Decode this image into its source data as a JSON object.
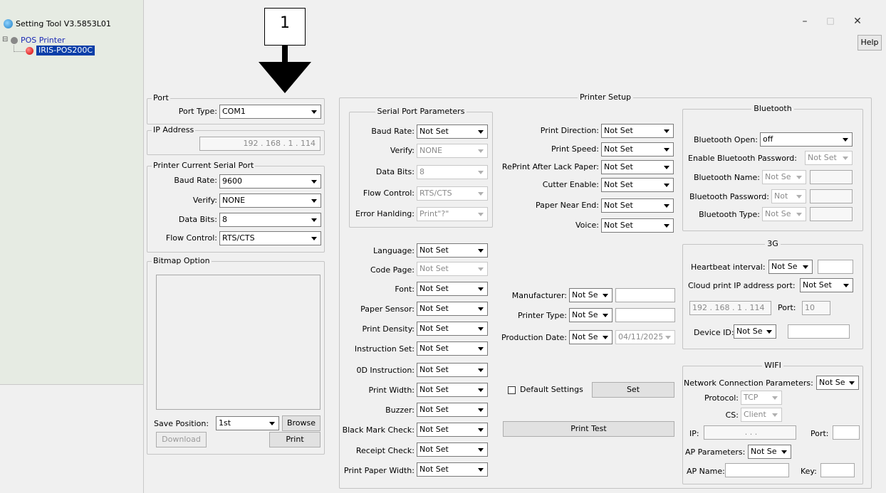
{
  "window": {
    "title": "Setting Tool V3.5853L01",
    "help_label": "Help",
    "minimize": "–",
    "maximize": "□",
    "close": "✕"
  },
  "callout": {
    "number": "1"
  },
  "tree": {
    "root_label": "POS Printer",
    "root_expander": "⊟",
    "child_label": "IRIS-POS200C"
  },
  "port": {
    "title": "Port",
    "port_type_label": "Port Type:",
    "port_type_value": "COM1"
  },
  "ip_address": {
    "title": "IP Address",
    "value": "192  .  168  .   1   .  114"
  },
  "current_serial": {
    "title": "Printer Current Serial Port",
    "rows": [
      {
        "label": "Baud Rate:",
        "value": "9600"
      },
      {
        "label": "Verify:",
        "value": "NONE"
      },
      {
        "label": "Data Bits:",
        "value": "8"
      },
      {
        "label": "Flow Control:",
        "value": "RTS/CTS"
      }
    ]
  },
  "bitmap": {
    "title": "Bitmap Option",
    "save_position_label": "Save Position:",
    "save_position_value": "1st",
    "browse_label": "Browse",
    "download_label": "Download",
    "print_label": "Print"
  },
  "setup": {
    "title": "Printer Setup",
    "serial_title": "Serial Port Parameters",
    "serial_rows": [
      {
        "label": "Baud Rate:",
        "value": "Not Set",
        "disabled": false
      },
      {
        "label": "Verify:",
        "value": "NONE",
        "disabled": true
      },
      {
        "label": "Data Bits:",
        "value": "8",
        "disabled": true
      },
      {
        "label": "Flow Control:",
        "value": "RTS/CTS",
        "disabled": true
      },
      {
        "label": "Error Hanlding:",
        "value": "Print\"?\"",
        "disabled": true
      }
    ],
    "mid_rows": [
      {
        "label": "Print Direction:",
        "value": "Not Set"
      },
      {
        "label": "Print Speed:",
        "value": "Not Set"
      },
      {
        "label": "RePrint After Lack Paper:",
        "value": "Not Set"
      },
      {
        "label": "Cutter Enable:",
        "value": "Not Set"
      },
      {
        "label": "Paper Near End:",
        "value": "Not Set"
      },
      {
        "label": "Voice:",
        "value": "Not Set"
      }
    ],
    "left_rows": [
      {
        "label": "Language:",
        "value": "Not Set",
        "disabled": false
      },
      {
        "label": "Code Page:",
        "value": "Not Set",
        "disabled": true
      },
      {
        "label": "Font:",
        "value": "Not Set",
        "disabled": false
      },
      {
        "label": "Paper Sensor:",
        "value": "Not Set",
        "disabled": false
      },
      {
        "label": "Print Density:",
        "value": "Not Set",
        "disabled": false
      },
      {
        "label": "Instruction Set:",
        "value": "Not Set",
        "disabled": false
      },
      {
        "label": "0D Instruction:",
        "value": "Not Set",
        "disabled": false
      },
      {
        "label": "Print Width:",
        "value": "Not Set",
        "disabled": false
      },
      {
        "label": "Buzzer:",
        "value": "Not Set",
        "disabled": false
      },
      {
        "label": "Black Mark Check:",
        "value": "Not Set",
        "disabled": false
      },
      {
        "label": "Receipt Check:",
        "value": "Not Set",
        "disabled": false
      },
      {
        "label": "Print Paper Width:",
        "value": "Not Set",
        "disabled": false
      }
    ],
    "manufacturer_label": "Manufacturer:",
    "manufacturer_value": "Not Se",
    "printer_type_label": "Printer Type:",
    "printer_type_value": "Not Se",
    "production_date_label": "Production Date:",
    "production_date_value": "Not Se",
    "production_date_input": "04/11/2025",
    "default_settings_label": "Default Settings",
    "set_label": "Set",
    "print_test_label": "Print Test"
  },
  "bluetooth": {
    "title": "Bluetooth",
    "open_label": "Bluetooth Open:",
    "open_value": "off",
    "enable_password_label": "Enable Bluetooth Password:",
    "enable_password_value": "Not Set",
    "name_label": "Bluetooth Name:",
    "name_value": "Not Se",
    "password_label": "Bluetooth Password:",
    "password_value": "Not",
    "type_label": "Bluetooth Type:",
    "type_value": "Not Se"
  },
  "g3": {
    "title": "3G",
    "heartbeat_label": "Heartbeat interval:",
    "heartbeat_value": "Not Se",
    "cloud_label": "Cloud print IP address port:",
    "cloud_value": "Not Set",
    "ip_value": "192 . 168 .  1  . 114",
    "port_label": "Port:",
    "port_value": "10",
    "device_id_label": "Device ID:",
    "device_id_value": "Not Se"
  },
  "wifi": {
    "title": "WIFI",
    "network_label": "Network Connection Parameters:",
    "network_value": "Not Se",
    "protocol_label": "Protocol:",
    "protocol_value": "TCP",
    "cs_label": "CS:",
    "cs_value": "Client",
    "ip_label": "IP:",
    "ip_value": ".       .       .",
    "port_label": "Port:",
    "ap_params_label": "AP Parameters:",
    "ap_params_value": "Not Se",
    "ap_name_label": "AP Name:",
    "key_label": "Key:"
  }
}
